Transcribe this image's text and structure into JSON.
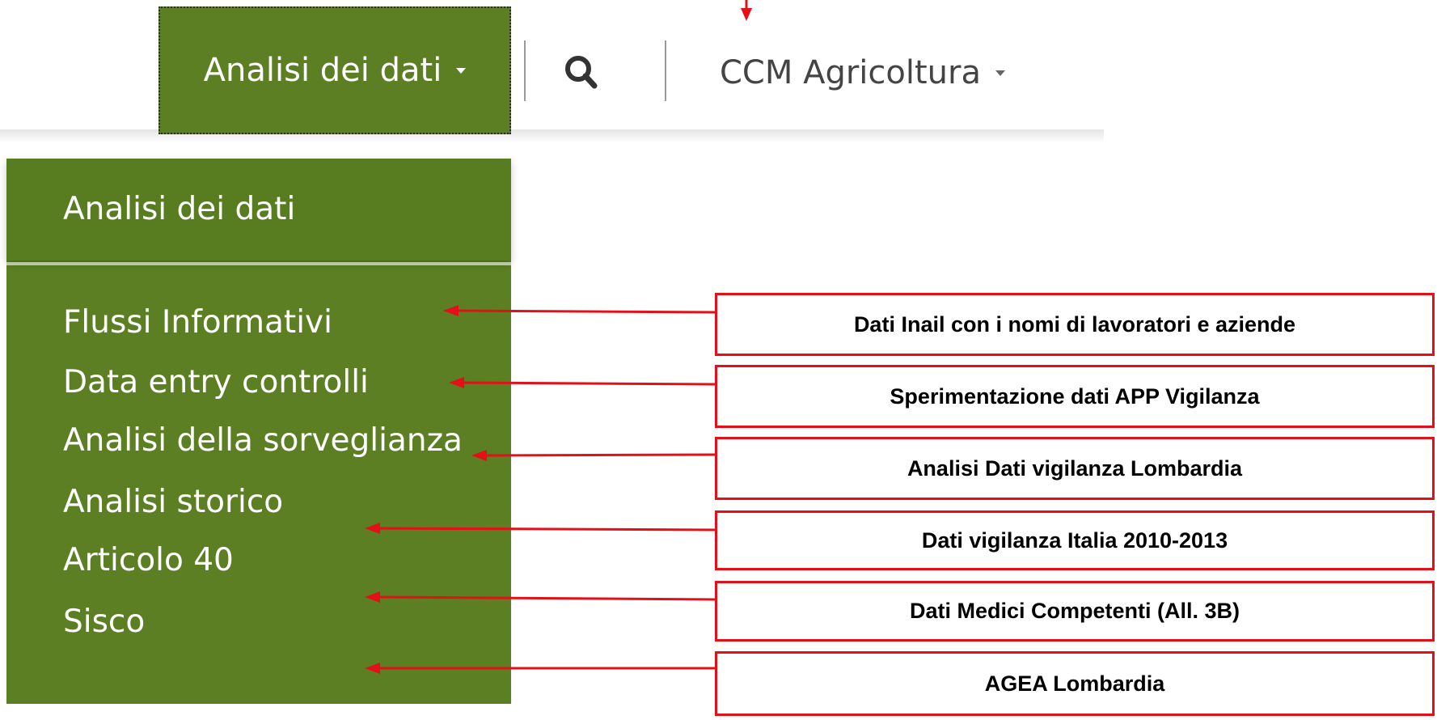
{
  "navbar": {
    "active_menu_label": "Analisi dei dati",
    "secondary_menu_label": "CCM Agricoltura"
  },
  "dropdown": {
    "header": "Analisi dei dati",
    "items": [
      {
        "label": "Flussi Informativi"
      },
      {
        "label": "Data entry controlli"
      },
      {
        "label": "Analisi della sorveglianza"
      },
      {
        "label": "Analisi storico"
      },
      {
        "label": "Articolo 40"
      },
      {
        "label": "Sisco"
      }
    ]
  },
  "annotations": [
    {
      "text": "Dati Inail con i nomi di lavoratori e aziende"
    },
    {
      "text": "Sperimentazione dati APP Vigilanza"
    },
    {
      "text": "Analisi Dati vigilanza Lombardia"
    },
    {
      "text": "Dati vigilanza Italia 2010-2013"
    },
    {
      "text": "Dati Medici Competenti (All. 3B)"
    },
    {
      "text": "AGEA Lombardia"
    }
  ],
  "icons": {
    "search": "search-icon",
    "caret": "caret-down-icon",
    "arrow": "arrow-left-icon"
  },
  "colors": {
    "menu_green": "#5b7f22",
    "annotation_red": "#e31018"
  }
}
